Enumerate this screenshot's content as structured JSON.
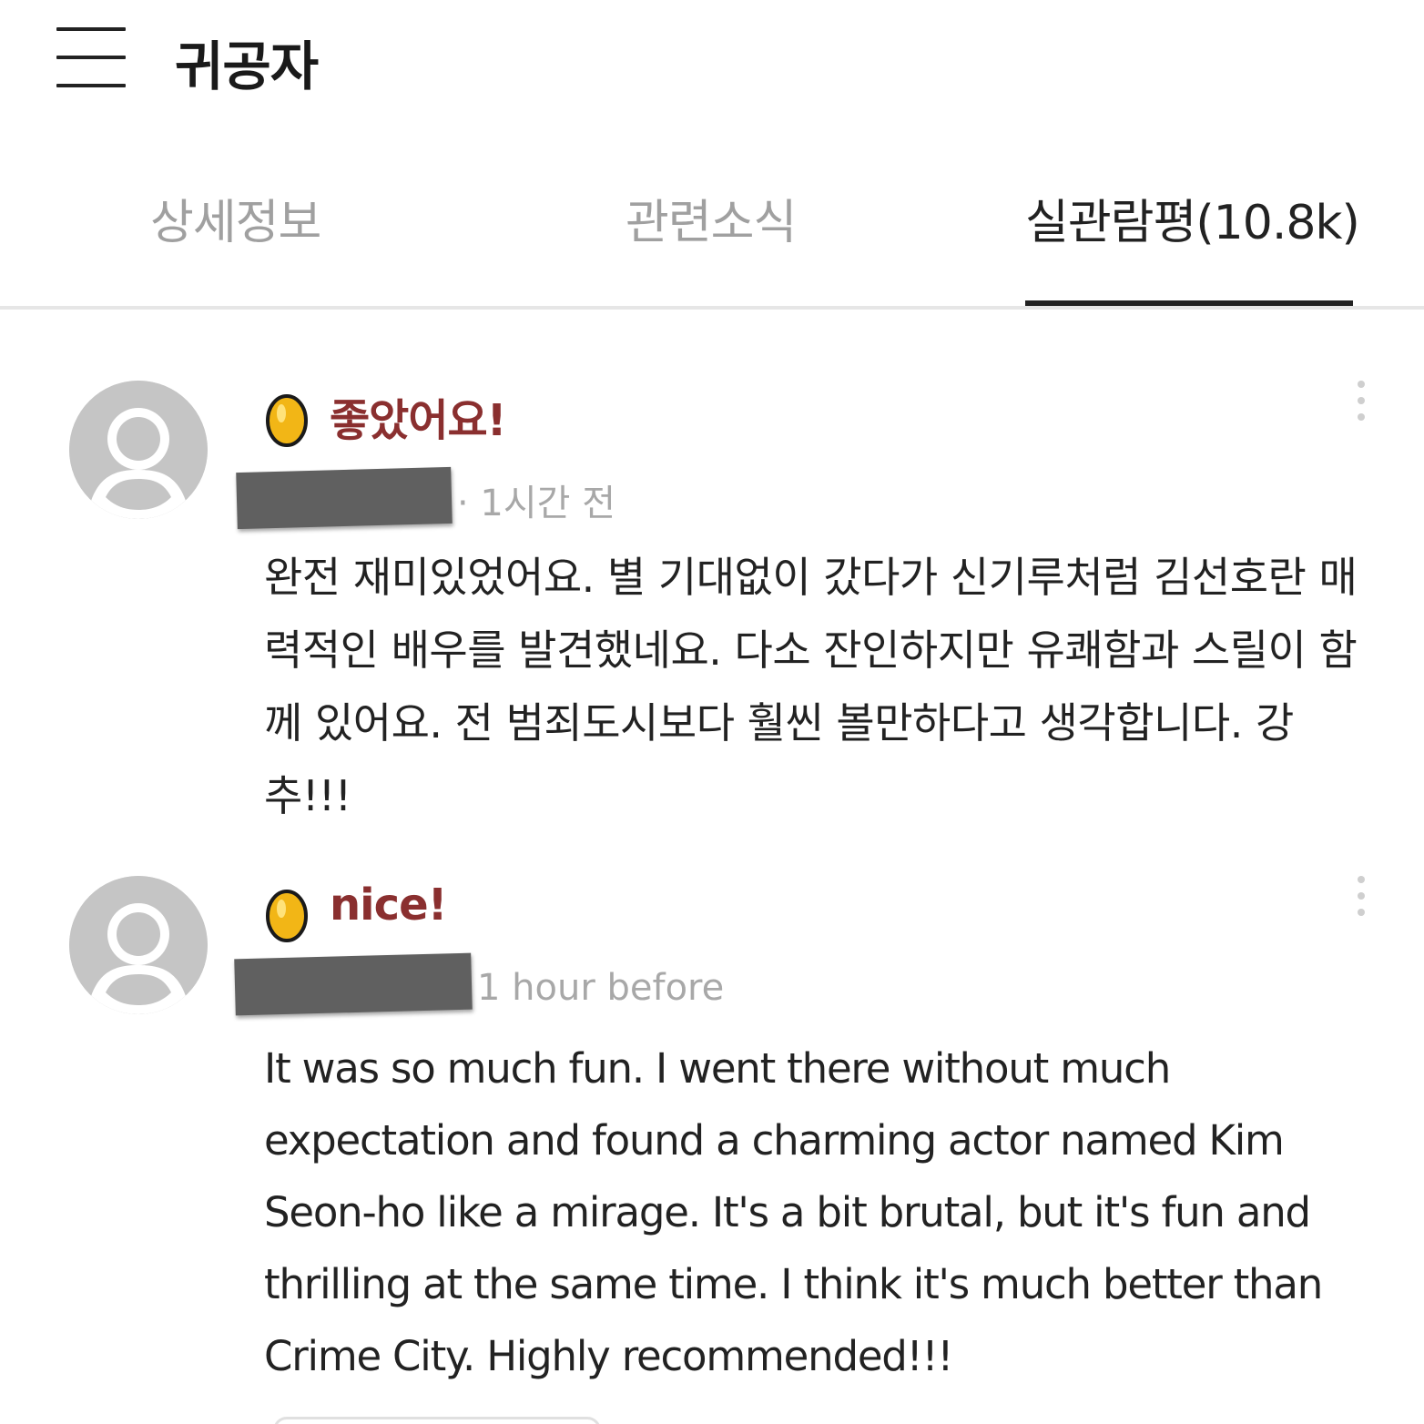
{
  "header": {
    "title": "귀공자",
    "menu_icon": "hamburger-menu-icon"
  },
  "tabs": [
    {
      "label": "상세정보",
      "active": false
    },
    {
      "label": "관련소식",
      "active": false
    },
    {
      "label": "실관람평(10.8k)",
      "active": true
    }
  ],
  "reviews": [
    {
      "rating_icon": "golden-egg-icon",
      "rating_label": "좋았어요!",
      "username": "",
      "time": "· 1시간 전",
      "text": "완전 재미있었어요. 별 기대없이 갔다가 신기루처럼 김선호란 매력적인 배우를 발견했네요. 다소 잔인하지만 유쾌함과 스릴이 함께 있어요. 전 범죄도시보다 훨씬 볼만하다고 생각합니다. 강추!!!"
    },
    {
      "rating_icon": "golden-egg-icon",
      "rating_label": "nice!",
      "username": "",
      "time": "1 hour before",
      "text": "It was so much fun. I went there without much expectation and found a charming actor named Kim Seon-ho like a mirage. It's a bit brutal, but it's fun and thrilling at the same time. I think it's much better than Crime City. Highly recommended!!!"
    }
  ],
  "colors": {
    "rating_label": "#8a2f2f",
    "egg": "#f2b616",
    "active_tab": "#222222",
    "inactive_tab": "#a0a0a0"
  }
}
